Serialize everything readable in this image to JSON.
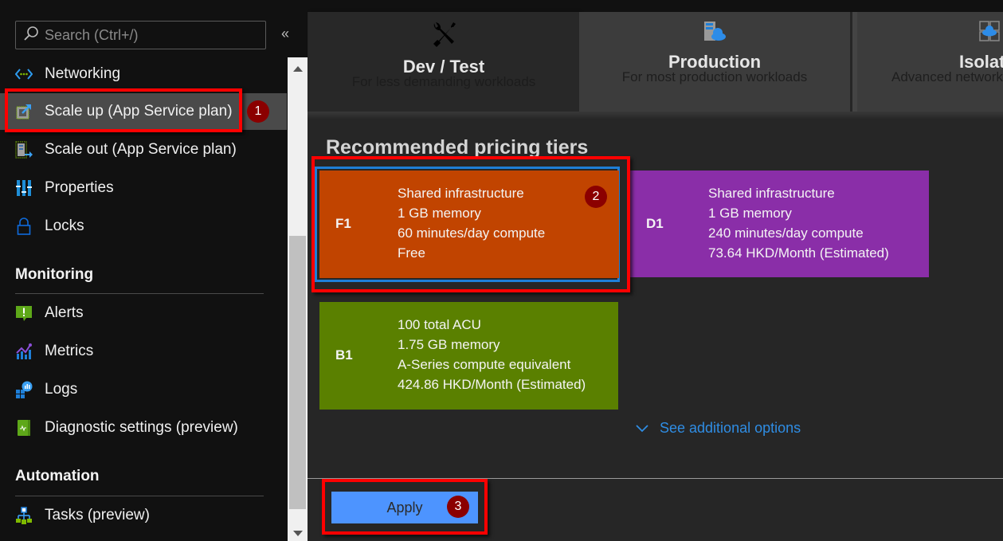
{
  "sidebar": {
    "search_placeholder": "Search (Ctrl+/)",
    "collapse_glyph": "«",
    "items_top": [
      {
        "label": "Networking",
        "icon": "networking-icon"
      },
      {
        "label": "Scale up (App Service plan)",
        "icon": "scale-up-icon",
        "selected": true
      },
      {
        "label": "Scale out (App Service plan)",
        "icon": "scale-out-icon"
      },
      {
        "label": "Properties",
        "icon": "properties-icon"
      },
      {
        "label": "Locks",
        "icon": "lock-icon"
      }
    ],
    "sections": [
      {
        "title": "Monitoring",
        "items": [
          {
            "label": "Alerts",
            "icon": "alerts-icon"
          },
          {
            "label": "Metrics",
            "icon": "metrics-icon"
          },
          {
            "label": "Logs",
            "icon": "logs-icon"
          },
          {
            "label": "Diagnostic settings (preview)",
            "icon": "diagnostic-settings-icon"
          }
        ]
      },
      {
        "title": "Automation",
        "items": [
          {
            "label": "Tasks (preview)",
            "icon": "tasks-icon"
          }
        ]
      }
    ]
  },
  "main": {
    "tabs": [
      {
        "title": "Dev / Test",
        "subtitle": "For less demanding workloads",
        "icon": "tools-icon",
        "active": true
      },
      {
        "title": "Production",
        "subtitle": "For most production workloads",
        "icon": "server-cloud-icon",
        "active": false
      },
      {
        "title": "Isolated",
        "subtitle": "Advanced networking and scale",
        "icon": "isolated-cloud-icon",
        "active": false
      }
    ],
    "recommended_title": "Recommended pricing tiers",
    "tiers": [
      {
        "code": "F1",
        "color": "#c14400",
        "selected": true,
        "lines": [
          "Shared infrastructure",
          "1 GB memory",
          "60 minutes/day compute",
          "Free"
        ]
      },
      {
        "code": "D1",
        "color": "#8a2ea8",
        "selected": false,
        "lines": [
          "Shared infrastructure",
          "1 GB memory",
          "240 minutes/day compute",
          "73.64 HKD/Month (Estimated)"
        ]
      },
      {
        "code": "B1",
        "color": "#5a8000",
        "selected": false,
        "lines": [
          "100 total ACU",
          "1.75 GB memory",
          "A-Series compute equivalent",
          "424.86 HKD/Month (Estimated)"
        ]
      }
    ],
    "see_more_label": "See additional options",
    "apply_label": "Apply"
  },
  "annotations": {
    "step1": "1",
    "step2": "2",
    "step3": "3",
    "highlight_color": "#ff0000",
    "badge_color": "#8b0000"
  }
}
